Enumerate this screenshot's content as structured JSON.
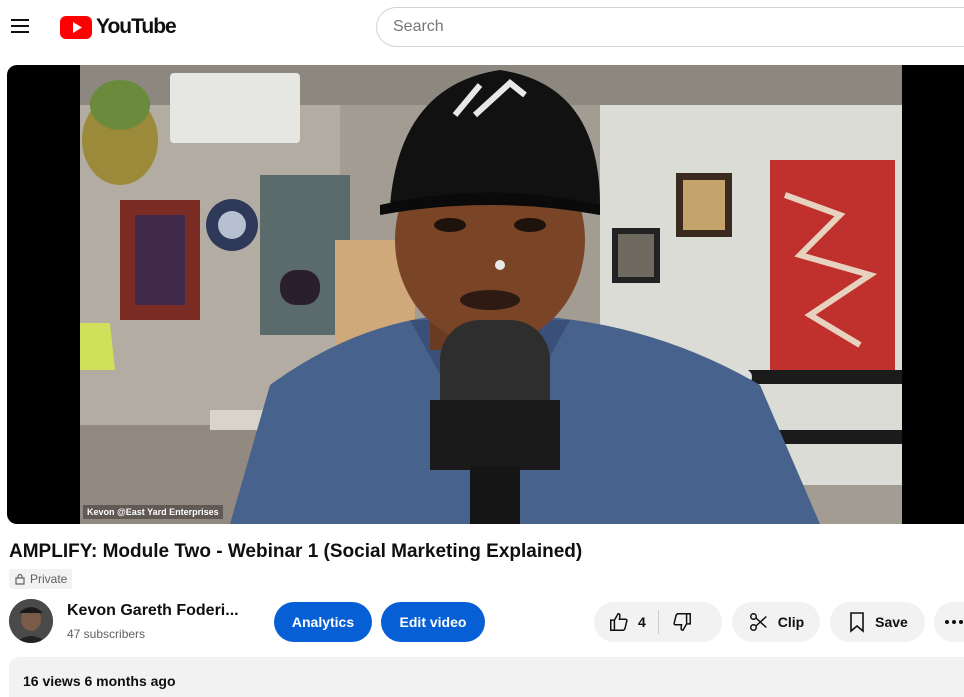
{
  "header": {
    "logo_text": "YouTube",
    "search_placeholder": "Search"
  },
  "video": {
    "overlay_caption": "Kevon @East Yard Enterprises",
    "title": "AMPLIFY: Module Two - Webinar 1 (Social Marketing Explained)",
    "privacy": "Private"
  },
  "channel": {
    "name": "Kevon Gareth Foderi...",
    "subscribers": "47 subscribers"
  },
  "actions": {
    "analytics": "Analytics",
    "edit_video": "Edit video",
    "like_count": "4",
    "clip": "Clip",
    "save": "Save"
  },
  "description": {
    "views": "16 views",
    "date": "6 months ago"
  },
  "colors": {
    "brand_red": "#ff0000",
    "primary_blue": "#065fd4",
    "chip_grey": "#f2f2f2"
  }
}
